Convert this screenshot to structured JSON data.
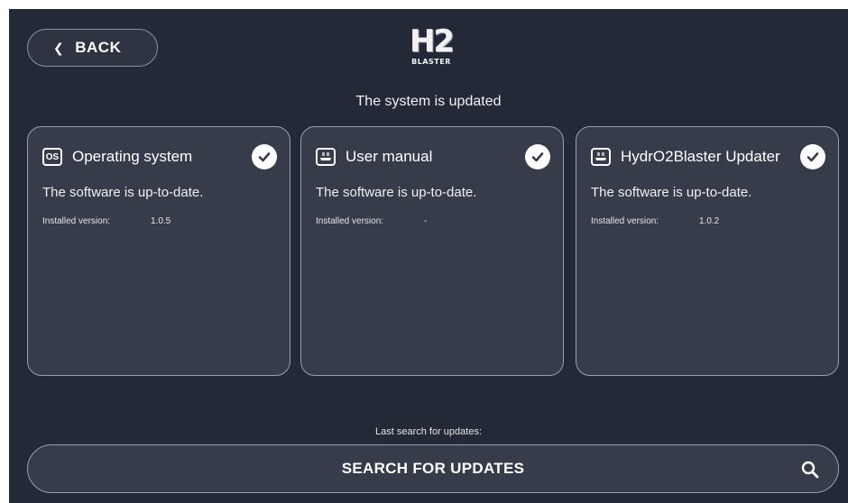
{
  "header": {
    "back_label": "BACK",
    "logo_main": "H2",
    "logo_sub": "BLASTER",
    "status": "The system is updated"
  },
  "cards": [
    {
      "icon": "os-icon",
      "icon_text": "OS",
      "title": "Operating system",
      "message": "The software is up-to-date.",
      "version_label": "Installed version:",
      "version": "1.0.5",
      "status_icon": "check-icon"
    },
    {
      "icon": "manual-icon",
      "title": "User manual",
      "message": "The software is up-to-date.",
      "version_label": "Installed version:",
      "version": "-",
      "status_icon": "check-icon"
    },
    {
      "icon": "updater-icon",
      "title": "HydrO2Blaster Updater",
      "message": "The software is up-to-date.",
      "version_label": "Installed version:",
      "version": "1.0.2",
      "status_icon": "check-icon"
    }
  ],
  "footer": {
    "last_search_label": "Last search for updates:",
    "search_button_label": "SEARCH FOR UPDATES",
    "search_icon": "search-icon"
  },
  "colors": {
    "background": "#242938",
    "card": "#373c4b",
    "border": "#9a9fab",
    "text": "#ffffff"
  }
}
